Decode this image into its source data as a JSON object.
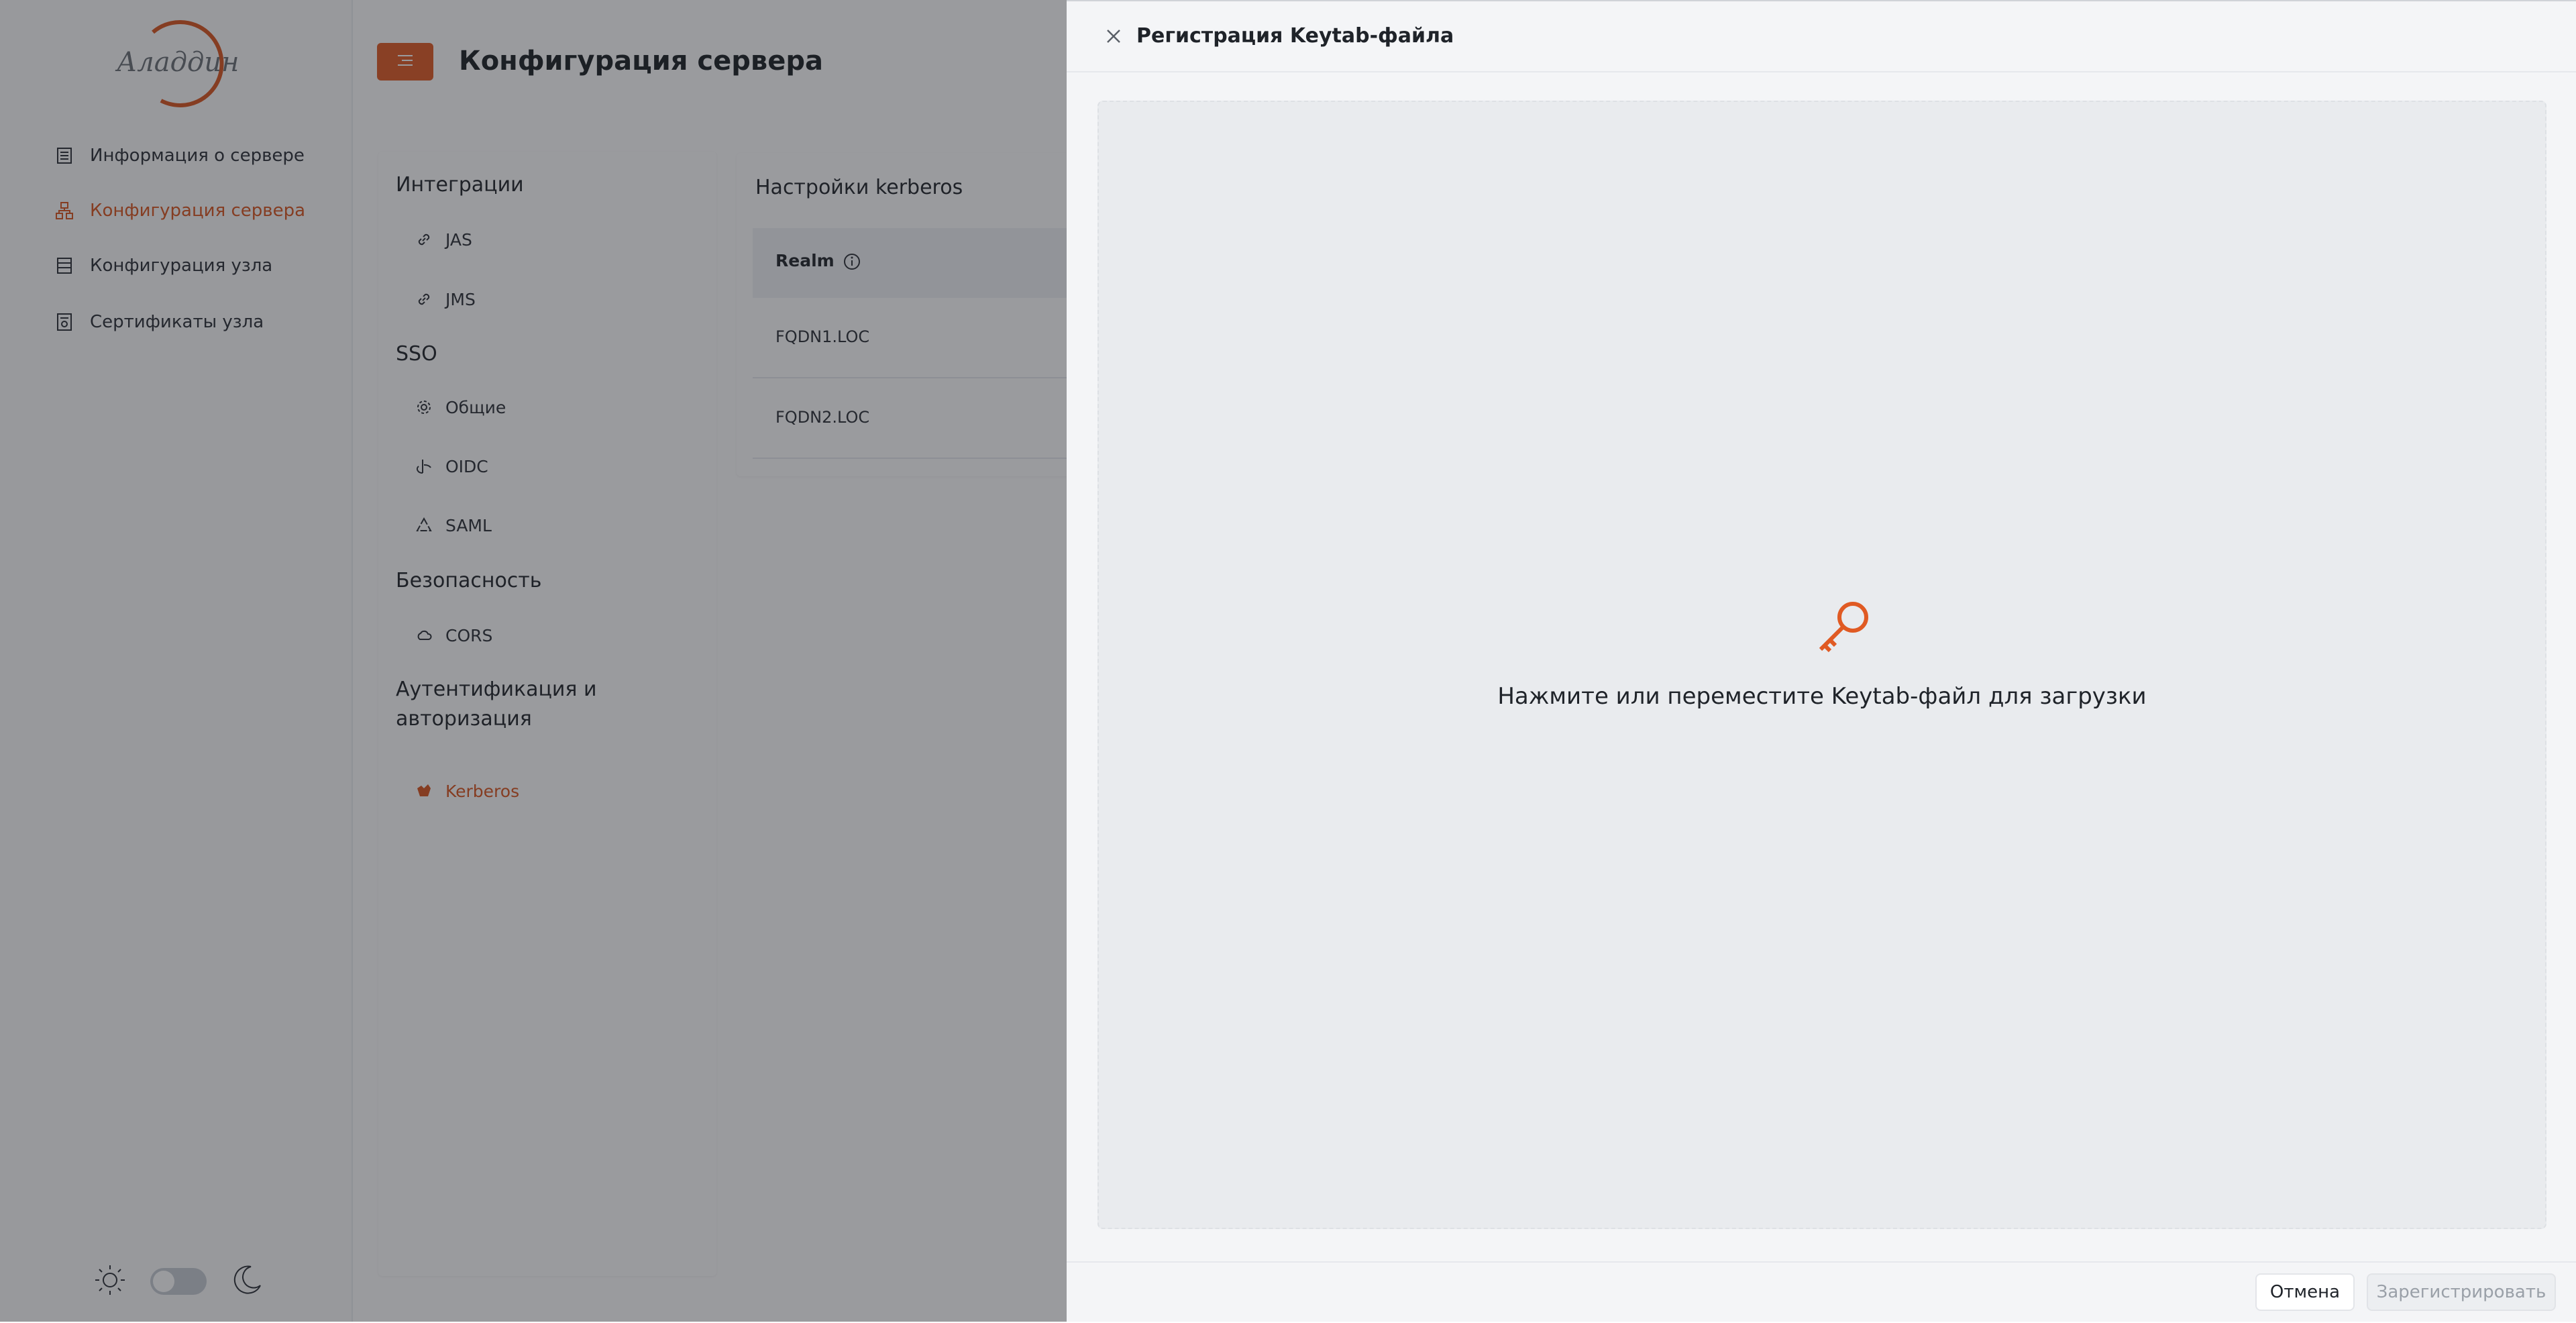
{
  "sidebar": {
    "logo_text": "Аладдин",
    "items": [
      {
        "label": "Информация о сервере",
        "icon": "server-info-icon"
      },
      {
        "label": "Конфигурация сервера",
        "icon": "server-config-icon",
        "active": true
      },
      {
        "label": "Конфигурация узла",
        "icon": "node-config-icon"
      },
      {
        "label": "Сертификаты узла",
        "icon": "certificate-icon"
      }
    ]
  },
  "header": {
    "title": "Конфигурация сервера",
    "menu_icon": "menu-icon"
  },
  "settings_menu": {
    "groups": [
      {
        "label": "Интеграции",
        "items": [
          {
            "label": "JAS",
            "icon": "link-icon"
          },
          {
            "label": "JMS",
            "icon": "link-icon"
          }
        ]
      },
      {
        "label": "SSO",
        "items": [
          {
            "label": "Общие",
            "icon": "gear-icon"
          },
          {
            "label": "OIDC",
            "icon": "oidc-icon"
          },
          {
            "label": "SAML",
            "icon": "saml-icon"
          }
        ]
      },
      {
        "label": "Безопасность",
        "items": [
          {
            "label": "CORS",
            "icon": "cloud-icon"
          }
        ]
      },
      {
        "label": "Аутентификация и авторизация",
        "items": [
          {
            "label": "Kerberos",
            "icon": "kerberos-icon",
            "active": true
          }
        ]
      }
    ]
  },
  "kerberos": {
    "title": "Настройки kerberos",
    "column": "Realm",
    "rows": [
      "FQDN1.LOC",
      "FQDN2.LOC"
    ]
  },
  "drawer": {
    "title": "Регистрация Keytab-файла",
    "drop_text": "Нажмите или переместите Keytab-файл для загрузки",
    "cancel_label": "Отмена",
    "register_label": "Зарегистрировать",
    "register_disabled": true
  },
  "colors": {
    "accent": "#e05a23",
    "overlay": "rgba(30,33,40,0.45)"
  }
}
